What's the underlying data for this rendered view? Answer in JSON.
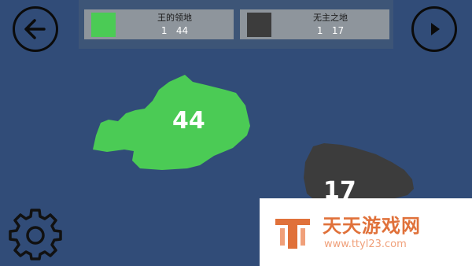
{
  "hud": {
    "player": {
      "name": "王的领地",
      "count_text": "1   44",
      "color": "#4bcb55"
    },
    "neutral": {
      "name": "无主之地",
      "count_text": "1   17",
      "color": "#3c3c3c"
    }
  },
  "map": {
    "territories": [
      {
        "owner": "player",
        "troops": "44",
        "color": "#4bcb55"
      },
      {
        "owner": "neutral",
        "troops": "17",
        "color": "#3c3c3c"
      }
    ]
  },
  "controls": {
    "back_icon": "arrow-left-icon",
    "play_icon": "play-icon",
    "settings_icon": "gear-icon"
  },
  "watermark": {
    "title": "天天游戏网",
    "url": "www.ttyl23.com"
  },
  "colors": {
    "background": "#314c78",
    "panel": "#3d5577",
    "card": "#8e959c",
    "accent": "#e0713a"
  }
}
